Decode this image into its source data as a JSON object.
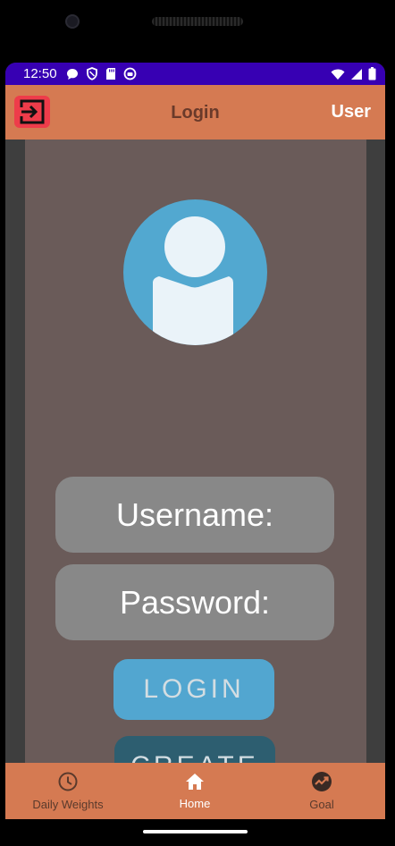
{
  "status_bar": {
    "time": "12:50",
    "color": "#3700b3",
    "left_icons": [
      "chat-bubble-icon",
      "shield-icon",
      "sd-card-icon",
      "android-icon"
    ],
    "right_icons": [
      "wifi-icon",
      "cellular-signal-icon",
      "battery-icon"
    ]
  },
  "app_bar": {
    "title": "Login",
    "user_label": "User",
    "color": "#d57a52",
    "logout_icon": "logout-icon"
  },
  "avatar": {
    "icon": "user-avatar-icon",
    "color": "#52a8d0"
  },
  "form": {
    "username_label": "Username:",
    "password_label": "Password:"
  },
  "buttons": {
    "login_label": "LOGIN",
    "create_label": "CREATE",
    "login_color": "#52a6d0",
    "create_color": "#2d5e70"
  },
  "bottom_nav": {
    "items": [
      {
        "label": "Daily Weights",
        "icon": "clock-icon",
        "active": false
      },
      {
        "label": "Home",
        "icon": "home-icon",
        "active": true
      },
      {
        "label": "Goal",
        "icon": "trending-icon",
        "active": false
      }
    ]
  }
}
